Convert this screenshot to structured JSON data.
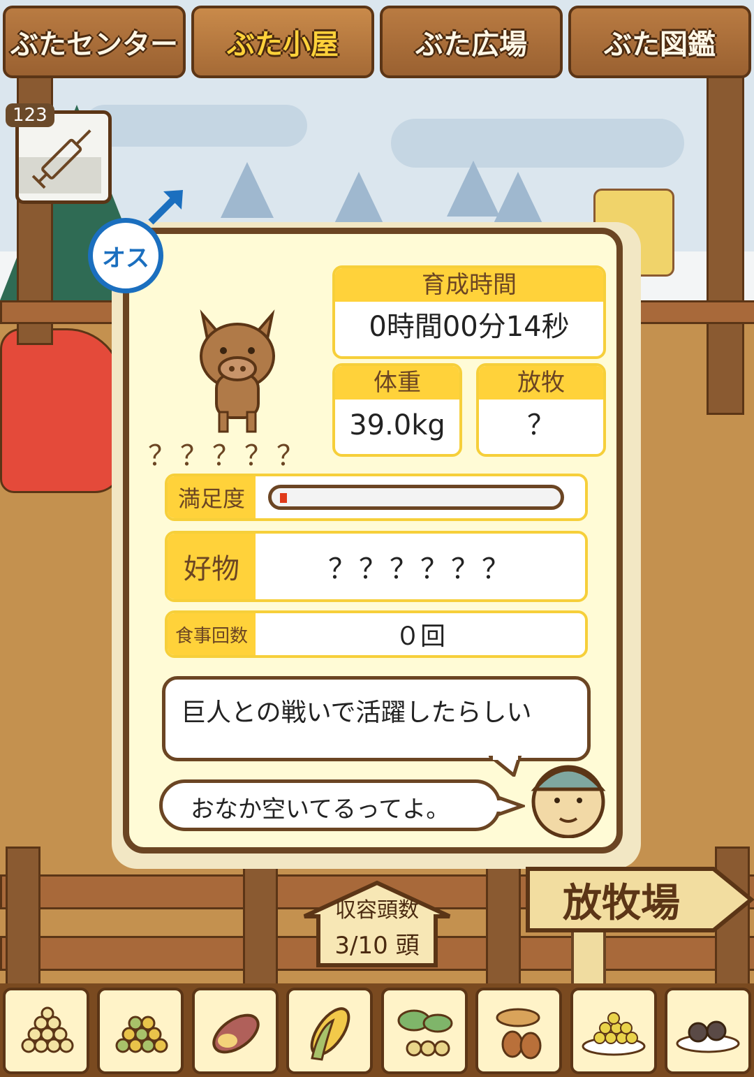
{
  "tabs": [
    {
      "label": "ぶたセンター",
      "active": false
    },
    {
      "label": "ぶた小屋",
      "active": true
    },
    {
      "label": "ぶた広場",
      "active": false
    },
    {
      "label": "ぶた図鑑",
      "active": false
    }
  ],
  "item": {
    "count": "123",
    "icon": "syringe-icon"
  },
  "pig": {
    "gender_label": "オス",
    "name": "？？？？？",
    "raise_time": {
      "label": "育成時間",
      "value": "0時間00分14秒"
    },
    "weight": {
      "label": "体重",
      "value": "39.0kg"
    },
    "graze": {
      "label": "放牧",
      "value": "？"
    },
    "satisfaction": {
      "label": "満足度",
      "level": 0.02
    },
    "favorite": {
      "label": "好物",
      "value": "？？？？？？"
    },
    "meals": {
      "label": "食事回数",
      "value": "０回"
    },
    "description": "巨人との戦いで活躍したらしい",
    "farmer_comment": "おなか空いてるってよ。"
  },
  "capacity": {
    "label": "収容頭数",
    "value": "3/10 頭"
  },
  "pasture_sign": "放牧場",
  "feeds": [
    {
      "icon": "soybeans-icon"
    },
    {
      "icon": "mixed-beans-icon"
    },
    {
      "icon": "sweet-potato-icon"
    },
    {
      "icon": "corn-icon"
    },
    {
      "icon": "leafy-greens-icon"
    },
    {
      "icon": "acorns-icon"
    },
    {
      "icon": "grain-plate-icon"
    },
    {
      "icon": "chocolate-plate-icon"
    }
  ],
  "colors": {
    "accent_yellow": "#ffd23a",
    "wood_dark": "#6b4523",
    "male_blue": "#1b6fbf"
  }
}
